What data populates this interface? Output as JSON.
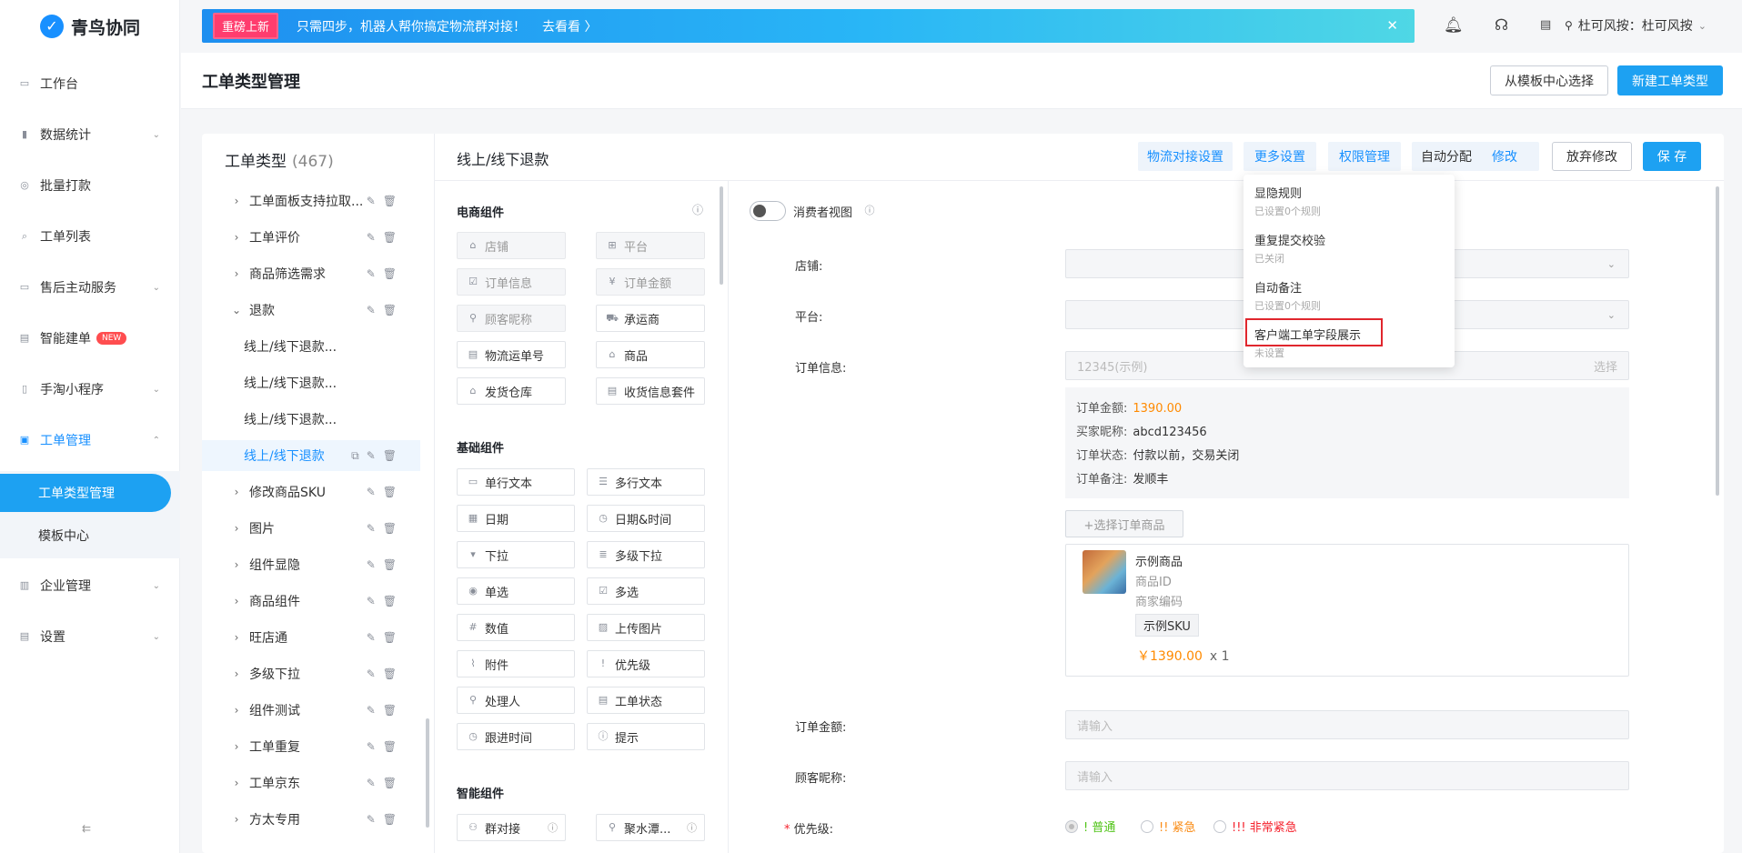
{
  "app": {
    "name": "青鸟协同"
  },
  "sidebar": {
    "items": [
      {
        "label": "工作台",
        "icon": "desktop-icon",
        "chev": ""
      },
      {
        "label": "数据统计",
        "icon": "bar-chart-icon",
        "chev": "⌄"
      },
      {
        "label": "批量打款",
        "icon": "coin-icon",
        "chev": ""
      },
      {
        "label": "工单列表",
        "icon": "search-icon",
        "chev": ""
      },
      {
        "label": "售后主动服务",
        "icon": "chat-icon",
        "chev": "⌄"
      },
      {
        "label": "智能建单",
        "icon": "doc-icon",
        "chev": "",
        "badge": "NEW"
      },
      {
        "label": "手淘小程序",
        "icon": "phone-icon",
        "chev": "⌄"
      },
      {
        "label": "工单管理",
        "icon": "ticket-icon",
        "chev": "⌃"
      },
      {
        "label": "企业管理",
        "icon": "building-icon",
        "chev": "⌄"
      },
      {
        "label": "设置",
        "icon": "settings-icon",
        "chev": "⌄"
      }
    ],
    "sub_items": [
      "工单类型管理",
      "模板中心"
    ],
    "collapse": "⇇"
  },
  "banner": {
    "tag": "重磅上新",
    "message": "只需四步，机器人帮你搞定物流群对接！",
    "link": "去看看 〉",
    "close": "✕"
  },
  "user": {
    "name": "杜可风按：杜可风按",
    "chev": "⌄"
  },
  "header": {
    "title": "工单类型管理",
    "template_btn": "从模板中心选择",
    "new_btn": "新建工单类型"
  },
  "types": {
    "title": "工单类型",
    "count": "(467)",
    "rows": [
      {
        "label": "工单面板支持拉取...",
        "arrow": "›",
        "child": false,
        "selected": false
      },
      {
        "label": "工单评价",
        "arrow": "›",
        "child": false,
        "selected": false
      },
      {
        "label": "商品筛选需求",
        "arrow": "›",
        "child": false,
        "selected": false
      },
      {
        "label": "退款",
        "arrow": "⌄",
        "child": false,
        "selected": false
      },
      {
        "label": "线上/线下退款...",
        "arrow": "",
        "child": true,
        "selected": false
      },
      {
        "label": "线上/线下退款...",
        "arrow": "",
        "child": true,
        "selected": false
      },
      {
        "label": "线上/线下退款...",
        "arrow": "",
        "child": true,
        "selected": false
      },
      {
        "label": "线上/线下退款",
        "arrow": "",
        "child": true,
        "selected": true
      },
      {
        "label": "修改商品SKU",
        "arrow": "›",
        "child": false,
        "selected": false
      },
      {
        "label": "图片",
        "arrow": "›",
        "child": false,
        "selected": false
      },
      {
        "label": "组件显隐",
        "arrow": "›",
        "child": false,
        "selected": false
      },
      {
        "label": "商品组件",
        "arrow": "›",
        "child": false,
        "selected": false
      },
      {
        "label": "旺店通",
        "arrow": "›",
        "child": false,
        "selected": false
      },
      {
        "label": "多级下拉",
        "arrow": "›",
        "child": false,
        "selected": false
      },
      {
        "label": "组件测试",
        "arrow": "›",
        "child": false,
        "selected": false
      },
      {
        "label": "工单重复",
        "arrow": "›",
        "child": false,
        "selected": false
      },
      {
        "label": "工单京东",
        "arrow": "›",
        "child": false,
        "selected": false
      },
      {
        "label": "方太专用",
        "arrow": "›",
        "child": false,
        "selected": false
      }
    ]
  },
  "editor": {
    "title": "线上/线下退款",
    "logistics_btn": "物流对接设置",
    "more_btn": "更多设置",
    "perm_btn": "权限管理",
    "auto_assign": "自动分配",
    "modify": "修改",
    "discard_btn": "放弃修改",
    "save_btn": "保 存"
  },
  "palette": {
    "ecommerce_title": "电商组件",
    "ecommerce": [
      {
        "label": "店铺",
        "icon": "shop-icon",
        "disabled": true
      },
      {
        "label": "平台",
        "icon": "grid-icon",
        "disabled": true
      },
      {
        "label": "订单信息",
        "icon": "order-icon",
        "disabled": true
      },
      {
        "label": "订单金额",
        "icon": "money-icon",
        "disabled": true
      },
      {
        "label": "顾客昵称",
        "icon": "user-icon",
        "disabled": true
      },
      {
        "label": "承运商",
        "icon": "truck-icon",
        "disabled": false
      },
      {
        "label": "物流运单号",
        "icon": "waybill-icon",
        "disabled": false
      },
      {
        "label": "商品",
        "icon": "bag-icon",
        "disabled": false
      },
      {
        "label": "发货仓库",
        "icon": "warehouse-icon",
        "disabled": false
      },
      {
        "label": "收货信息套件",
        "icon": "receive-icon",
        "disabled": false
      }
    ],
    "basic_title": "基础组件",
    "basic": [
      {
        "label": "单行文本",
        "icon": "text-icon"
      },
      {
        "label": "多行文本",
        "icon": "multiline-icon"
      },
      {
        "label": "日期",
        "icon": "calendar-icon"
      },
      {
        "label": "日期&时间",
        "icon": "clock-icon"
      },
      {
        "label": "下拉",
        "icon": "dropdown-icon"
      },
      {
        "label": "多级下拉",
        "icon": "cascade-icon"
      },
      {
        "label": "单选",
        "icon": "radio-icon"
      },
      {
        "label": "多选",
        "icon": "checkbox-icon"
      },
      {
        "label": "数值",
        "icon": "number-icon"
      },
      {
        "label": "上传图片",
        "icon": "image-icon"
      },
      {
        "label": "附件",
        "icon": "paperclip-icon"
      },
      {
        "label": "优先级",
        "icon": "priority-icon"
      },
      {
        "label": "处理人",
        "icon": "handler-icon"
      },
      {
        "label": "工单状态",
        "icon": "status-icon"
      },
      {
        "label": "跟进时间",
        "icon": "followup-icon"
      },
      {
        "label": "提示",
        "icon": "tip-icon"
      }
    ],
    "smart_title": "智能组件",
    "smart": [
      {
        "label": "群对接",
        "icon": "group-icon"
      },
      {
        "label": "聚水潭...",
        "icon": "jst-icon"
      }
    ]
  },
  "form": {
    "consumer_view": "消费者视图",
    "labels": {
      "shop": "店铺:",
      "platform": "平台:",
      "order_info": "订单信息:",
      "order_amount": "订单金额:",
      "nickname": "顾客昵称:",
      "priority": "优先级:"
    },
    "required_mark": "*",
    "order_placeholder": "12345(示例)",
    "order_select": "选择",
    "order_details": [
      {
        "k": "订单金额:",
        "v": "1390.00",
        "highlight": true
      },
      {
        "k": "买家昵称:",
        "v": "abcd123456",
        "highlight": false
      },
      {
        "k": "订单状态:",
        "v": "付款以前，交易关闭",
        "highlight": false
      },
      {
        "k": "订单备注:",
        "v": "发顺丰",
        "highlight": false
      }
    ],
    "pick_goods": "+选择订单商品",
    "product": {
      "name": "示例商品",
      "id": "商品ID",
      "code": "商家编码",
      "sku": "示例SKU",
      "price": "￥1390.00",
      "qty": "x 1"
    },
    "input_placeholder": "请输入",
    "priority_options": [
      {
        "label": "! 普通",
        "color": "#52c41a",
        "checked": true
      },
      {
        "label": "!! 紧急",
        "color": "#fa8c16",
        "checked": false
      },
      {
        "label": "!!! 非常紧急",
        "color": "#f5222d",
        "checked": false
      }
    ]
  },
  "dropdown": {
    "items": [
      {
        "title": "显隐规则",
        "sub": "已设置0个规则"
      },
      {
        "title": "重复提交校验",
        "sub": "已关闭"
      },
      {
        "title": "自动备注",
        "sub": "已设置0个规则"
      },
      {
        "title": "客户端工单字段展示",
        "sub": "未设置"
      }
    ]
  },
  "colors": {
    "accent": "#1da1f2",
    "link": "#1890ff",
    "price": "#ff8a00",
    "highlight_border": "#e0262d"
  }
}
